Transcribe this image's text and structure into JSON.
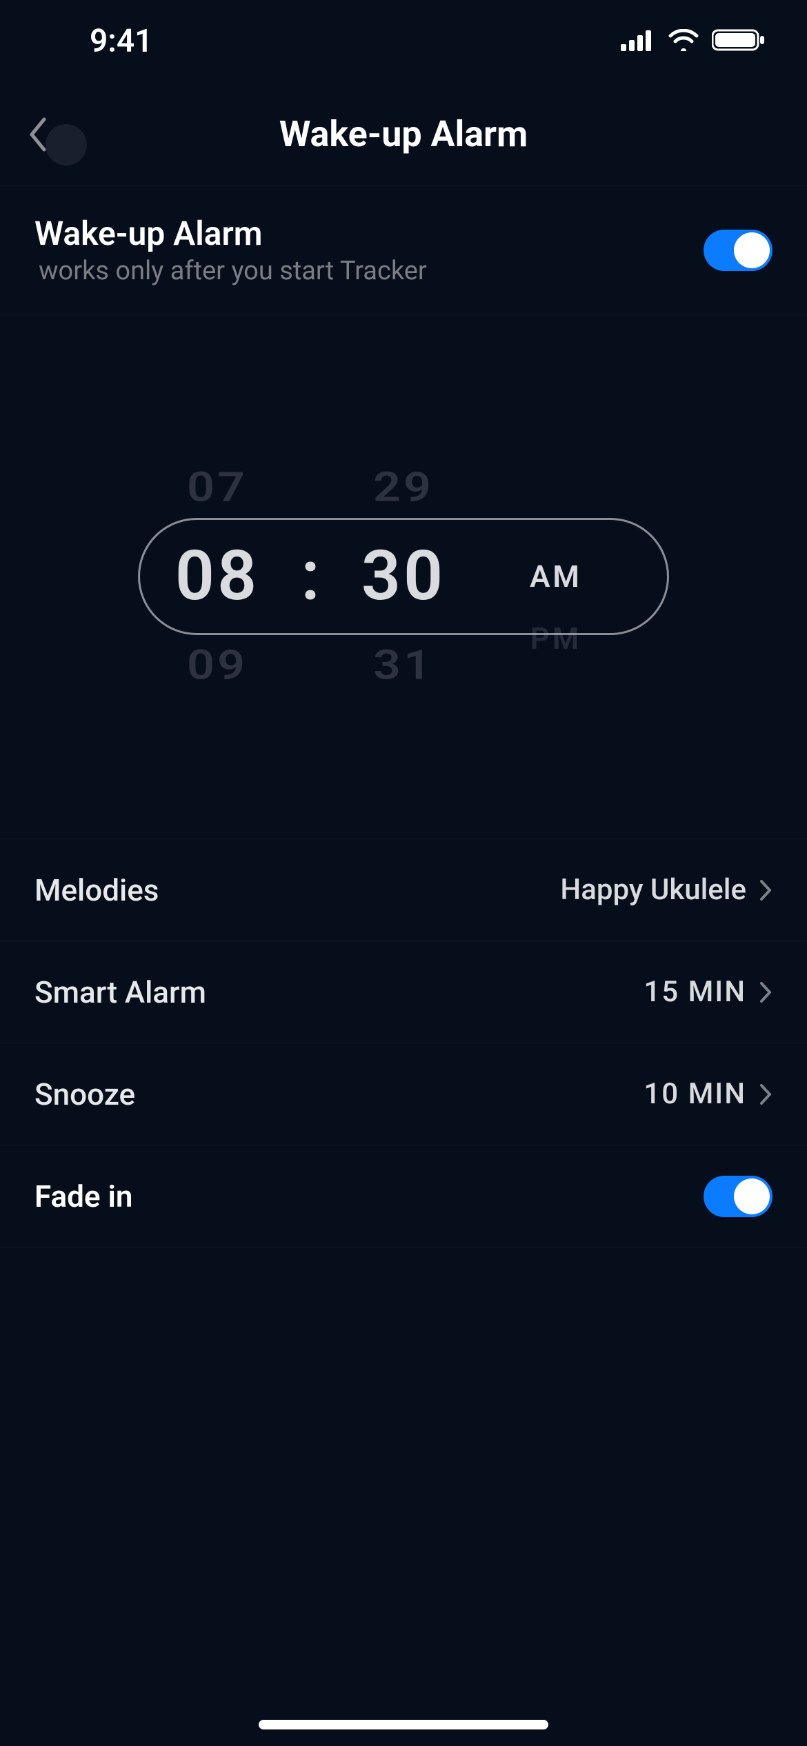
{
  "status": {
    "time": "9:41"
  },
  "nav": {
    "title": "Wake-up Alarm"
  },
  "alarmToggle": {
    "title": "Wake-up Alarm",
    "subtitle": "works only after you start Tracker",
    "on": true
  },
  "picker": {
    "hours": {
      "prev": "07",
      "selected": "08",
      "next": "09"
    },
    "minutes": {
      "prev": "29",
      "selected": "30",
      "next": "31"
    },
    "ampm": {
      "selected": "AM",
      "other": "PM"
    },
    "separator": ":"
  },
  "rows": {
    "melodies": {
      "label": "Melodies",
      "value": "Happy Ukulele"
    },
    "smartAlarm": {
      "label": "Smart Alarm",
      "value": "15 MIN"
    },
    "snooze": {
      "label": "Snooze",
      "value": "10 MIN"
    },
    "fadeIn": {
      "label": "Fade in",
      "on": true
    }
  }
}
